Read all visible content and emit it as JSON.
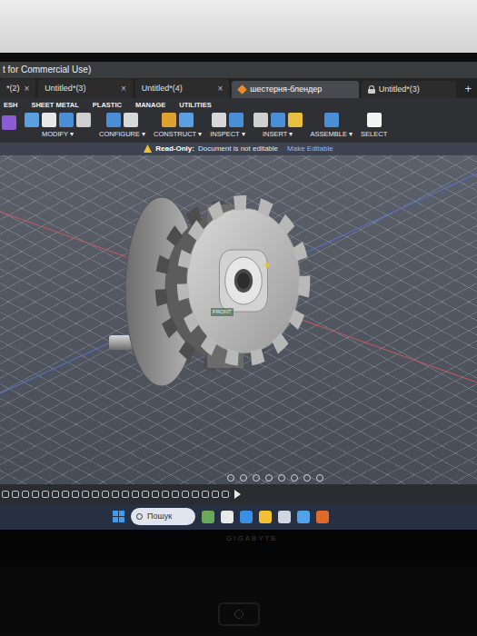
{
  "window": {
    "title": "t for Commercial Use)"
  },
  "tabs": [
    {
      "label": "*(2)",
      "close": "×",
      "selected": false,
      "locked": false
    },
    {
      "label": "Untitled*(3)",
      "close": "×",
      "selected": false,
      "locked": false
    },
    {
      "label": "Untitled*(4)",
      "close": "×",
      "selected": false,
      "locked": false
    },
    {
      "label": "шестерня-блендер",
      "selected": true,
      "locked": false
    },
    {
      "label": "Untitled*(3)",
      "selected": false,
      "locked": true
    }
  ],
  "new_tab": "+",
  "toolbar": {
    "workspaces": [
      "ESH",
      "SHEET METAL",
      "PLASTIC",
      "MANAGE",
      "UTILITIES"
    ],
    "groups": [
      "MODIFY ▾",
      "CONFIGURE ▾",
      "CONSTRUCT ▾",
      "INSPECT ▾",
      "INSERT ▾",
      "ASSEMBLE ▾",
      "SELECT"
    ]
  },
  "banner": {
    "label": "Read-Only:",
    "message": "Document is not editable",
    "action": "Make Editable"
  },
  "viewport": {
    "view_label": "FRONT"
  },
  "taskbar": {
    "search": "Пошук"
  },
  "laptop": {
    "brand": "GIGABYTE"
  }
}
